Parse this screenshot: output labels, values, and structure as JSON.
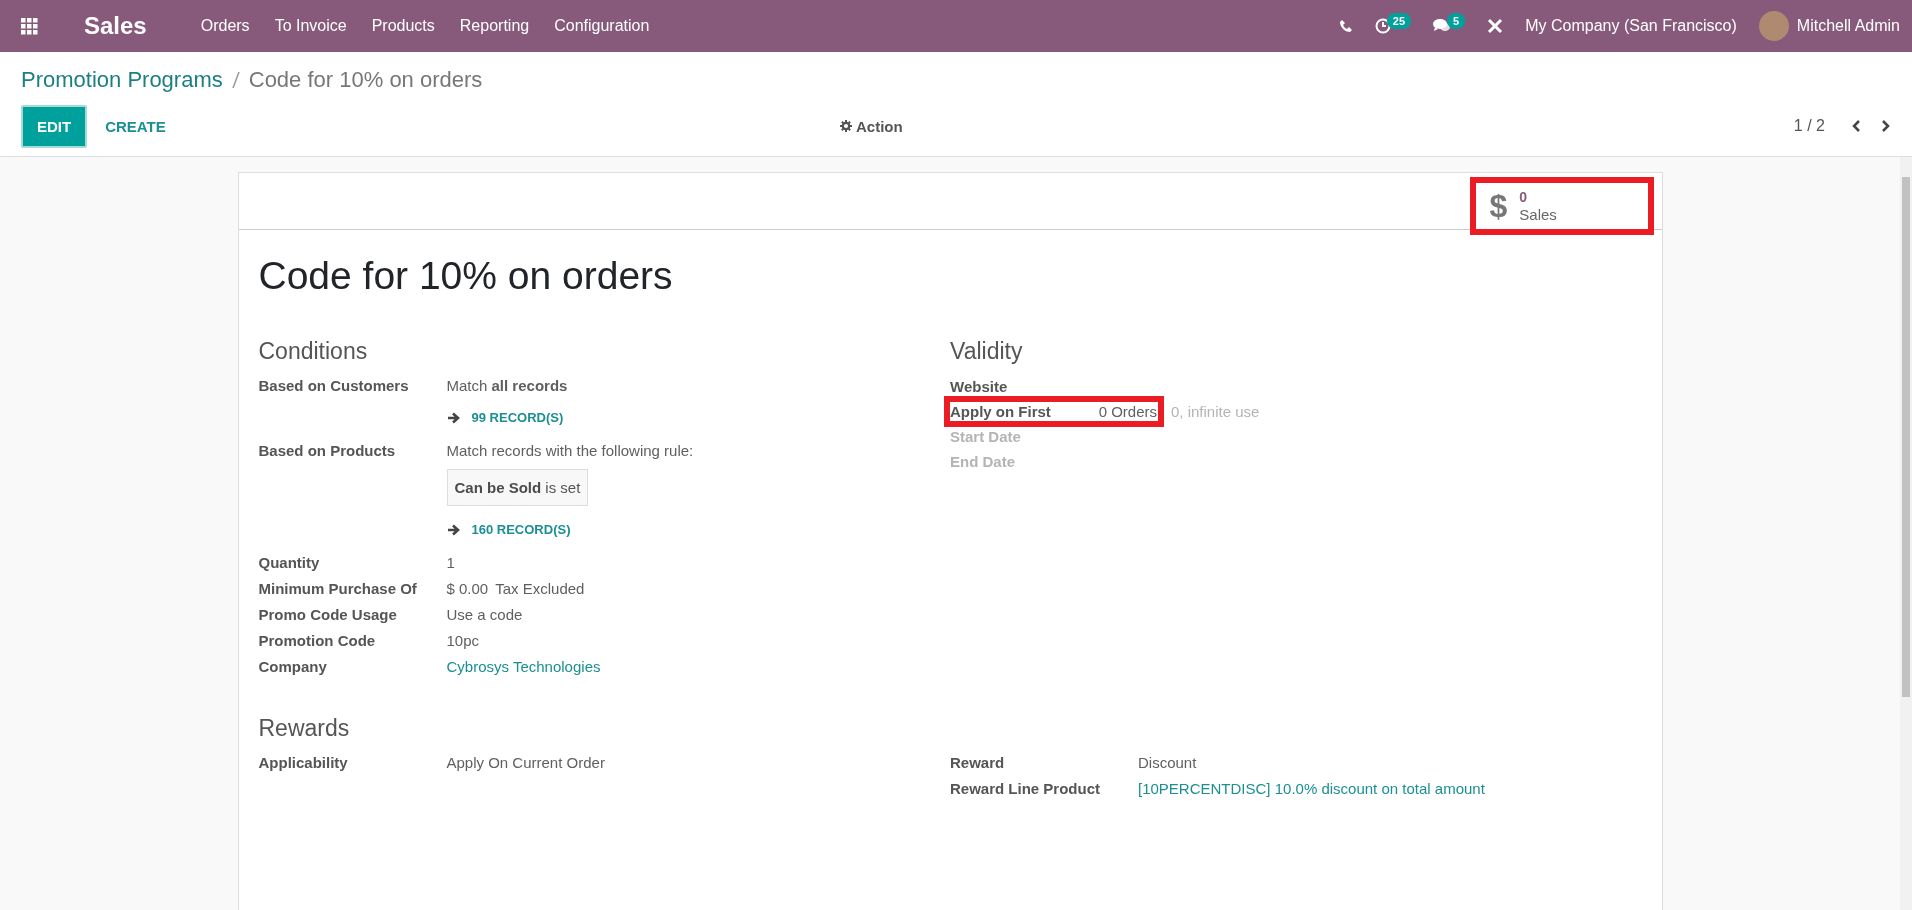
{
  "navbar": {
    "app_name": "Sales",
    "menu": [
      "Orders",
      "To Invoice",
      "Products",
      "Reporting",
      "Configuration"
    ],
    "activity_count": "25",
    "message_count": "5",
    "company": "My Company (San Francisco)",
    "user": "Mitchell Admin"
  },
  "breadcrumb": [
    "Promotion Programs",
    "Code for 10% on orders"
  ],
  "buttons": [
    {
      "label": "EDIT",
      "kind": "primary"
    },
    {
      "label": "CREATE",
      "kind": "link"
    }
  ],
  "action": "Action",
  "pager": "1 / 2",
  "sheet": {
    "smart_button": {
      "icon": "$",
      "value": "0",
      "label": "Sales",
      "highlighted": true
    },
    "title": "Code for 10% on orders",
    "conditions": {
      "heading": "Conditions",
      "fields": [
        {
          "label": "Based on Customers",
          "parts": [
            {
              "kind": "text",
              "text": "Match **all records**"
            },
            {
              "kind": "records",
              "text": "99 RECORD(S)"
            }
          ]
        },
        {
          "label": "Based on Products",
          "parts": [
            {
              "kind": "text",
              "text": "Match records with the following rule:"
            },
            {
              "kind": "rule",
              "field": "Can be Sold",
              "operator": "is set"
            },
            {
              "kind": "records",
              "text": "160 RECORD(S)"
            }
          ]
        },
        {
          "label": "Quantity",
          "parts": [
            {
              "kind": "text",
              "text": "1"
            }
          ]
        },
        {
          "label": "Minimum Purchase Of",
          "parts": [
            {
              "kind": "text",
              "text": "$ 0.00"
            },
            {
              "kind": "text",
              "text": "Tax Excluded"
            }
          ]
        },
        {
          "label": "Promo Code Usage",
          "parts": [
            {
              "kind": "text",
              "text": "Use a code"
            }
          ]
        },
        {
          "label": "Promotion Code",
          "parts": [
            {
              "kind": "text",
              "text": "10pc"
            }
          ]
        },
        {
          "label": "Company",
          "parts": [
            {
              "kind": "link",
              "text": "Cybrosys Technologies"
            }
          ]
        }
      ]
    },
    "validity": {
      "heading": "Validity",
      "fields": [
        {
          "label": "Website",
          "muted": false,
          "highlighted": false
        },
        {
          "label": "Apply on First",
          "value": "0 Orders",
          "note": "0, infinite use",
          "muted": false,
          "highlighted": true
        },
        {
          "label": "Start Date",
          "muted": true,
          "highlighted": false
        },
        {
          "label": "End Date",
          "muted": true,
          "highlighted": false
        }
      ]
    },
    "rewards": {
      "heading": "Rewards",
      "left": [
        {
          "label": "Applicability",
          "parts": [
            {
              "kind": "text",
              "text": "Apply On Current Order"
            }
          ]
        }
      ],
      "right": [
        {
          "label": "Reward",
          "parts": [
            {
              "kind": "text",
              "text": "Discount"
            }
          ]
        },
        {
          "label": "Reward Line Product",
          "parts": [
            {
              "kind": "link",
              "text": "[10PERCENTDISC] 10.0% discount on total amount"
            }
          ]
        }
      ]
    }
  }
}
